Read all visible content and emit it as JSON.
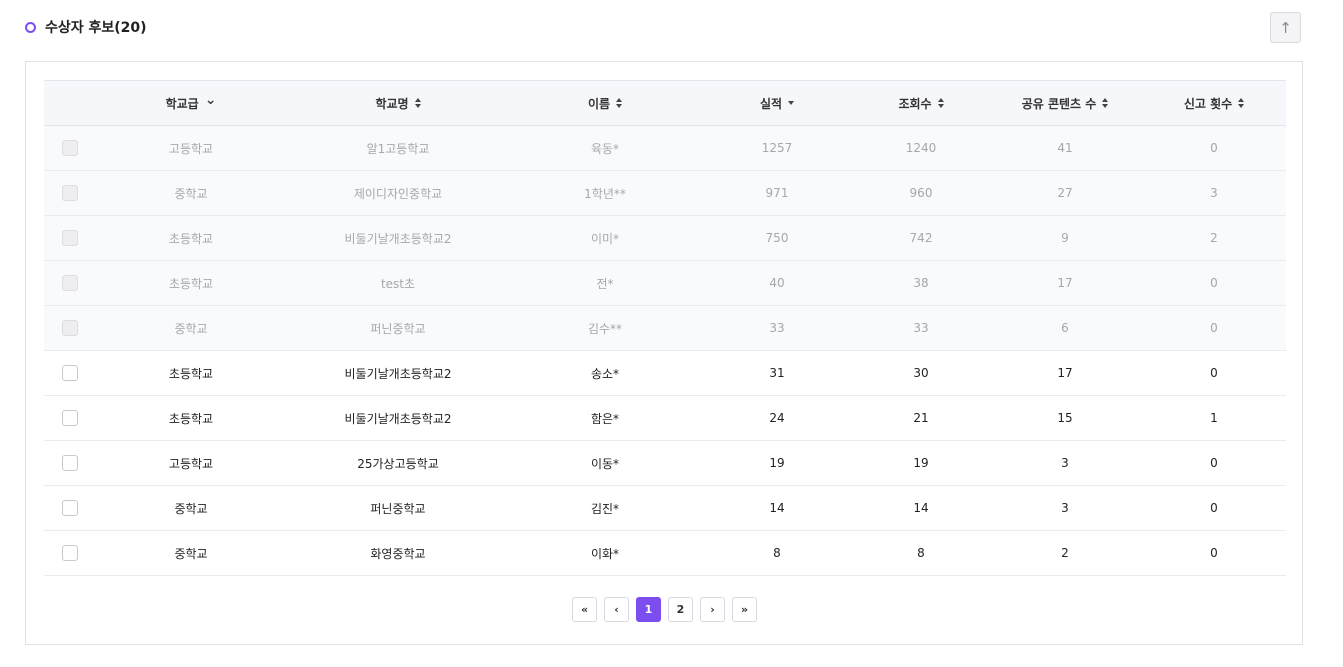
{
  "header": {
    "title": "수상자 후보(20)"
  },
  "colors": {
    "accent": "#7c4ef0",
    "header_bg": "#f6f7fa",
    "disabled_text": "#a6a6ae"
  },
  "table": {
    "columns": [
      {
        "label": "학교급",
        "sort": "chevron-down"
      },
      {
        "label": "학교명",
        "sort": "both"
      },
      {
        "label": "이름",
        "sort": "both"
      },
      {
        "label": "실적",
        "sort": "desc"
      },
      {
        "label": "조회수",
        "sort": "both"
      },
      {
        "label": "공유 콘텐츠 수",
        "sort": "both"
      },
      {
        "label": "신고 횟수",
        "sort": "both"
      }
    ],
    "rows": [
      {
        "disabled": true,
        "cells": [
          "고등학교",
          "알1고등학교",
          "육동*",
          "1257",
          "1240",
          "41",
          "0"
        ]
      },
      {
        "disabled": true,
        "cells": [
          "중학교",
          "제이디자인중학교",
          "1학년**",
          "971",
          "960",
          "27",
          "3"
        ]
      },
      {
        "disabled": true,
        "cells": [
          "초등학교",
          "비둘기날개초등학교2",
          "이미*",
          "750",
          "742",
          "9",
          "2"
        ]
      },
      {
        "disabled": true,
        "cells": [
          "초등학교",
          "test초",
          "전*",
          "40",
          "38",
          "17",
          "0"
        ]
      },
      {
        "disabled": true,
        "cells": [
          "중학교",
          "퍼닌중학교",
          "김수**",
          "33",
          "33",
          "6",
          "0"
        ]
      },
      {
        "disabled": false,
        "cells": [
          "초등학교",
          "비둘기날개초등학교2",
          "송소*",
          "31",
          "30",
          "17",
          "0"
        ]
      },
      {
        "disabled": false,
        "cells": [
          "초등학교",
          "비둘기날개초등학교2",
          "함은*",
          "24",
          "21",
          "15",
          "1"
        ]
      },
      {
        "disabled": false,
        "cells": [
          "고등학교",
          "25가상고등학교",
          "이동*",
          "19",
          "19",
          "3",
          "0"
        ]
      },
      {
        "disabled": false,
        "cells": [
          "중학교",
          "퍼닌중학교",
          "김진*",
          "14",
          "14",
          "3",
          "0"
        ]
      },
      {
        "disabled": false,
        "cells": [
          "중학교",
          "화영중학교",
          "이화*",
          "8",
          "8",
          "2",
          "0"
        ]
      }
    ]
  },
  "pagination": {
    "first": "«",
    "prev": "‹",
    "pages": [
      "1",
      "2"
    ],
    "active_page": "1",
    "next": "›",
    "last": "»"
  },
  "icons": {
    "scroll_top": "arrow-up-icon"
  }
}
